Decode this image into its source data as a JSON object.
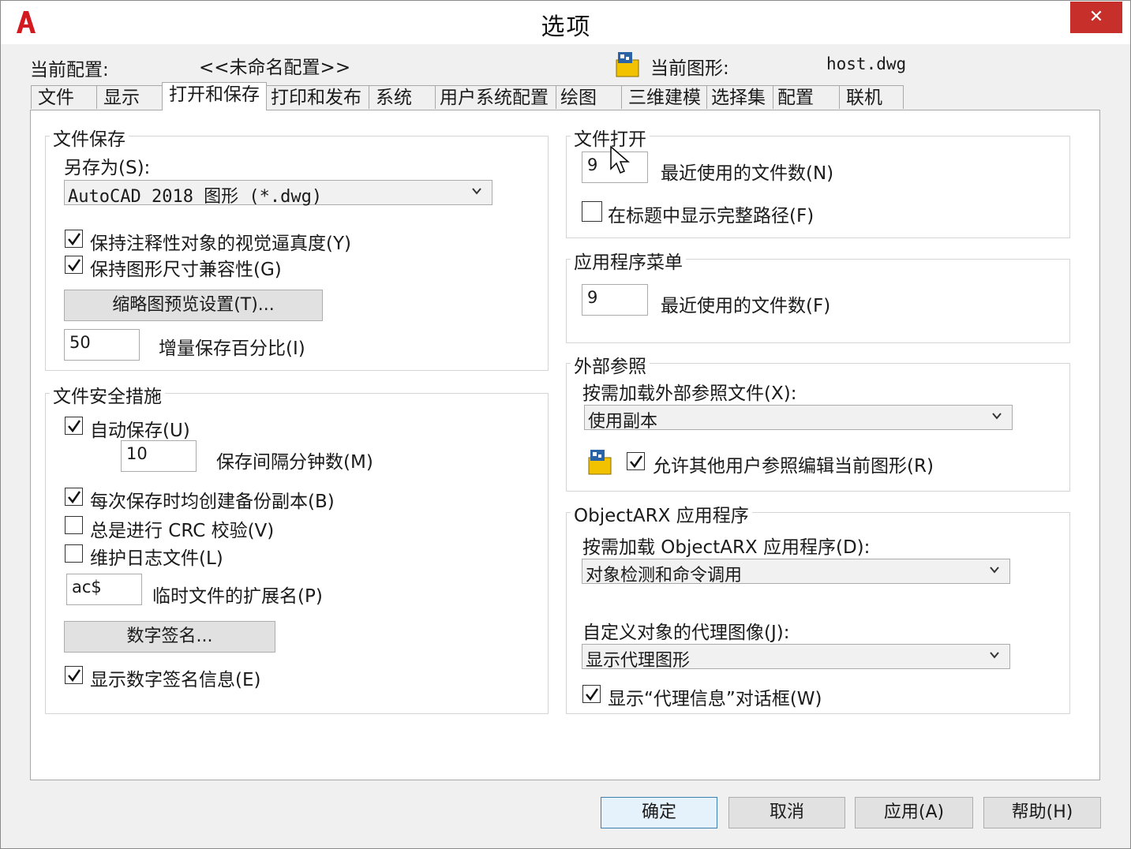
{
  "window": {
    "title": "选项",
    "close_glyph": "✕",
    "app_icon": "autocad-logo-icon"
  },
  "profile": {
    "current_profile_label": "当前配置:",
    "current_profile_value": "<<未命名配置>>",
    "current_drawing_label": "当前图形:",
    "current_drawing_value": "host.dwg",
    "drawing_icon": "drawing-file-icon"
  },
  "tabs": [
    {
      "label": "文件"
    },
    {
      "label": "显示"
    },
    {
      "label": "打开和保存",
      "active": true
    },
    {
      "label": "打印和发布"
    },
    {
      "label": "系统"
    },
    {
      "label": "用户系统配置"
    },
    {
      "label": "绘图"
    },
    {
      "label": "三维建模"
    },
    {
      "label": "选择集"
    },
    {
      "label": "配置"
    },
    {
      "label": "联机"
    }
  ],
  "file_save": {
    "title": "文件保存",
    "save_as_label": "另存为(S):",
    "save_as_value": "AutoCAD 2018 图形 (*.dwg)",
    "maintain_visual_fidelity": {
      "label": "保持注释性对象的视觉逼真度(Y)",
      "checked": true
    },
    "maintain_drawing_size": {
      "label": "保持图形尺寸兼容性(G)",
      "checked": true
    },
    "thumbnail_button": "缩略图预览设置(T)...",
    "incremental_value": "50",
    "incremental_label": "增量保存百分比(I)"
  },
  "file_safety": {
    "title": "文件安全措施",
    "autosave": {
      "label": "自动保存(U)",
      "checked": true
    },
    "minutes_value": "10",
    "minutes_label": "保存间隔分钟数(M)",
    "backup": {
      "label": "每次保存时均创建备份副本(B)",
      "checked": true
    },
    "crc": {
      "label": "总是进行 CRC 校验(V)",
      "checked": false
    },
    "log": {
      "label": "维护日志文件(L)",
      "checked": false
    },
    "temp_ext_value": "ac$",
    "temp_ext_label": "临时文件的扩展名(P)",
    "digital_sig_button": "数字签名...",
    "show_sig_info": {
      "label": "显示数字签名信息(E)",
      "checked": true
    }
  },
  "file_open": {
    "title": "文件打开",
    "recent_value": "9",
    "recent_label": "最近使用的文件数(N)",
    "full_path": {
      "label": "在标题中显示完整路径(F)",
      "checked": false
    }
  },
  "app_menu": {
    "title": "应用程序菜单",
    "recent_value": "9",
    "recent_label": "最近使用的文件数(F)"
  },
  "xref": {
    "title": "外部参照",
    "demand_load_label": "按需加载外部参照文件(X):",
    "demand_load_value": "使用副本",
    "allow_edit": {
      "label": "允许其他用户参照编辑当前图形(R)",
      "checked": true
    },
    "icon": "drawing-file-icon"
  },
  "objectarx": {
    "title": "ObjectARX 应用程序",
    "demand_load_label": "按需加载 ObjectARX 应用程序(D):",
    "demand_load_value": "对象检测和命令调用",
    "proxy_label": "自定义对象的代理图像(J):",
    "proxy_value": "显示代理图形",
    "show_proxy_dialog": {
      "label": "显示“代理信息”对话框(W)",
      "checked": true
    }
  },
  "footer": {
    "ok": "确定",
    "cancel": "取消",
    "apply": "应用(A)",
    "help": "帮助(H)"
  },
  "colors": {
    "accent": "#3c7fb1",
    "close": "#c7302a",
    "autocad_red": "#d21a1f"
  }
}
